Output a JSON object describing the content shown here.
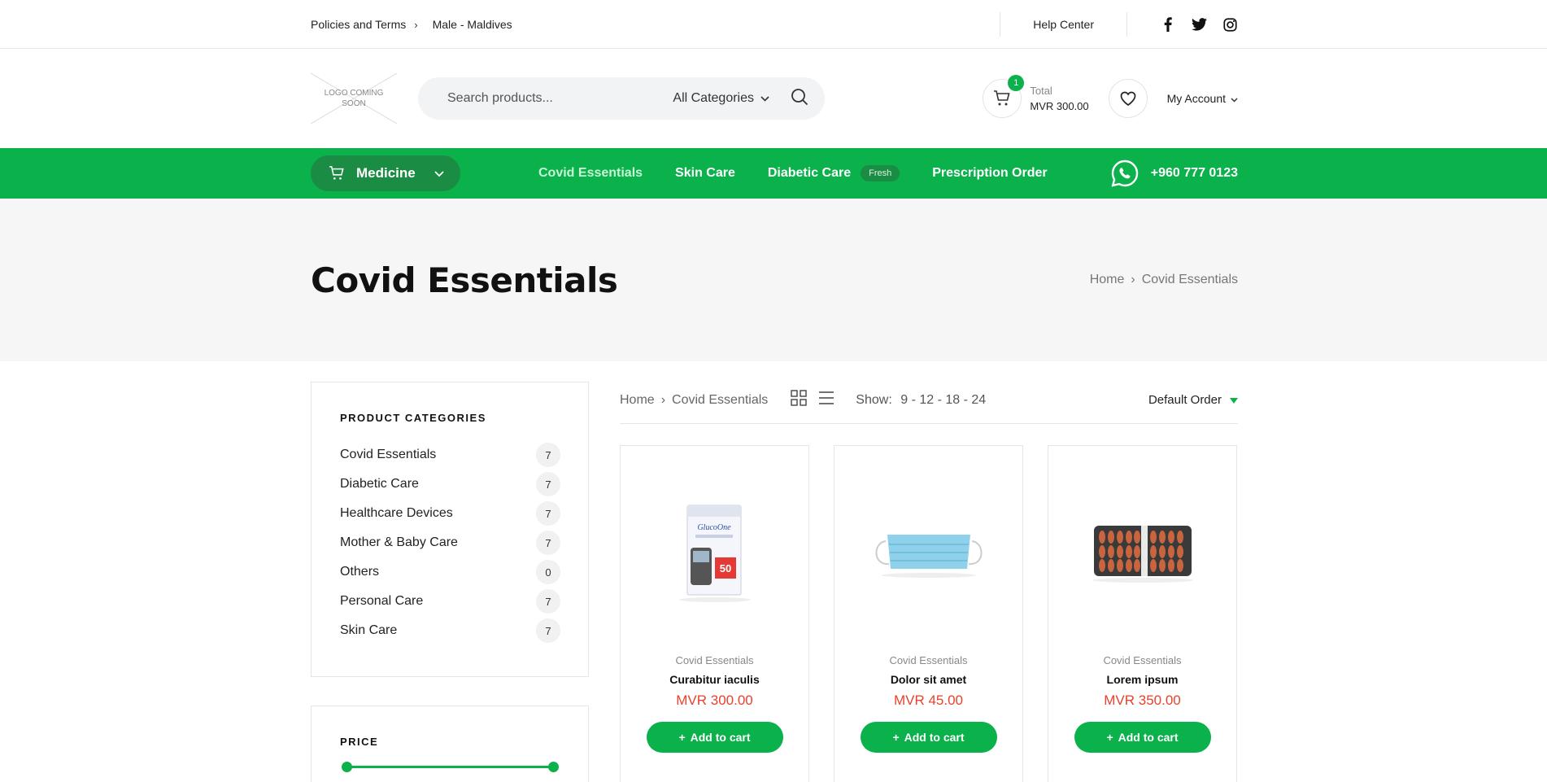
{
  "topbar": {
    "policies": "Policies and Terms",
    "location": "Male - Maldives",
    "help": "Help Center",
    "social": [
      "facebook-icon",
      "twitter-icon",
      "instagram-icon"
    ]
  },
  "header": {
    "logo_text": "LOGO COMING SOON",
    "search_placeholder": "Search products...",
    "category_select": "All Categories",
    "cart_count": "1",
    "cart_label": "Total",
    "cart_amount": "MVR 300.00",
    "account": "My Account"
  },
  "nav": {
    "department": "Medicine",
    "items": [
      {
        "label": "Covid Essentials",
        "active": true
      },
      {
        "label": "Skin Care"
      },
      {
        "label": "Diabetic Care",
        "badge": "Fresh"
      },
      {
        "label": "Prescription Order"
      }
    ],
    "phone": "+960 777 0123",
    "accent": "#0bb14b"
  },
  "page": {
    "title": "Covid Essentials",
    "breadcrumb": [
      "Home",
      "Covid Essentials"
    ]
  },
  "sidebar": {
    "categories_title": "PRODUCT CATEGORIES",
    "categories": [
      {
        "name": "Covid Essentials",
        "count": "7"
      },
      {
        "name": "Diabetic Care",
        "count": "7"
      },
      {
        "name": "Healthcare Devices",
        "count": "7"
      },
      {
        "name": "Mother & Baby Care",
        "count": "7"
      },
      {
        "name": "Others",
        "count": "0"
      },
      {
        "name": "Personal Care",
        "count": "7"
      },
      {
        "name": "Skin Care",
        "count": "7"
      }
    ],
    "price_title": "PRICE"
  },
  "toolbar": {
    "breadcrumb": [
      "Home",
      "Covid Essentials"
    ],
    "show_label": "Show:",
    "show_options": "9 - 12 - 18 - 24",
    "order": "Default Order"
  },
  "products": [
    {
      "category": "Covid Essentials",
      "name": "Curabitur iaculis",
      "price": "MVR 300.00",
      "add": "Add to cart"
    },
    {
      "category": "Covid Essentials",
      "name": "Dolor sit amet",
      "price": "MVR 45.00",
      "add": "Add to cart"
    },
    {
      "category": "Covid Essentials",
      "name": "Lorem ipsum",
      "price": "MVR 350.00",
      "add": "Add to cart"
    }
  ]
}
